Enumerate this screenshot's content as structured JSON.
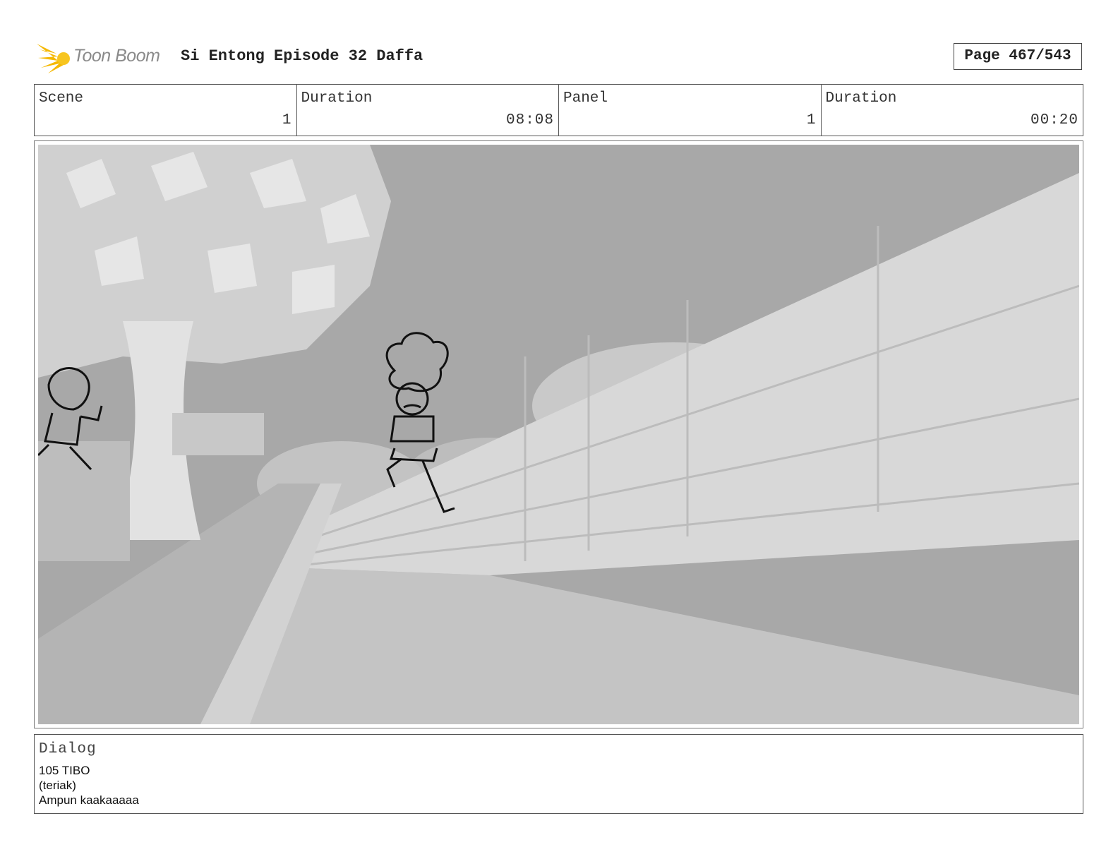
{
  "header": {
    "logo_text": "Toon Boom",
    "title": "Si Entong Episode 32 Daffa",
    "page": "Page 467/543"
  },
  "info": {
    "scene_label": "Scene",
    "scene_value": "1",
    "scene_duration_label": "Duration",
    "scene_duration_value": "08:08",
    "panel_label": "Panel",
    "panel_value": "1",
    "panel_duration_label": "Duration",
    "panel_duration_value": "00:20"
  },
  "dialog": {
    "label": "Dialog",
    "lines": [
      "105 TIBO",
      "(teriak)",
      "Ampun kaakaaaaa"
    ]
  },
  "colors": {
    "logo_accent": "#f5b800",
    "border": "#555555",
    "sky": "#a9a9a9",
    "fence": "#d6d6d6",
    "road": "#c4c4c4"
  }
}
